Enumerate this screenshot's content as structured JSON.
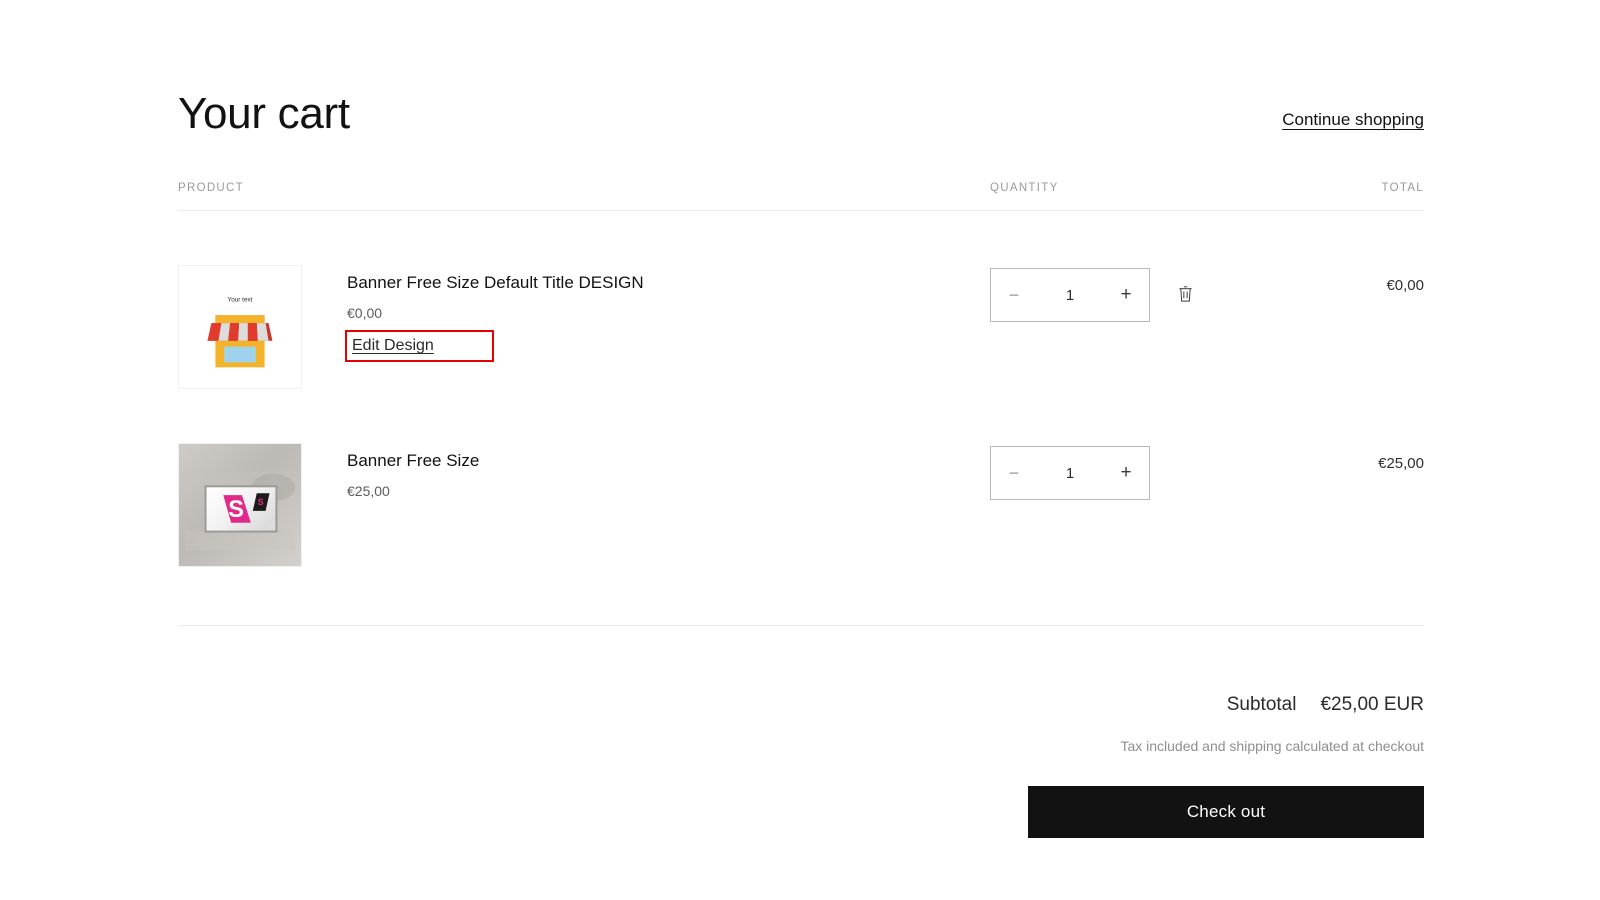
{
  "page": {
    "title": "Your cart",
    "continue_shopping_label": "Continue shopping"
  },
  "table": {
    "headers": {
      "product": "PRODUCT",
      "quantity": "QUANTITY",
      "total": "TOTAL"
    }
  },
  "items": [
    {
      "title": "Banner Free Size Default Title DESIGN",
      "price": "€0,00",
      "edit_link_label": "Edit Design",
      "quantity": "1",
      "decrease_label": "−",
      "increase_label": "+",
      "line_total": "€0,00",
      "thumbnail_icon": "storefront-icon",
      "thumbnail_caption": "Your text",
      "has_remove_button": true
    },
    {
      "title": "Banner Free Size",
      "price": "€25,00",
      "quantity": "1",
      "decrease_label": "−",
      "increase_label": "+",
      "line_total": "€25,00",
      "thumbnail_icon": "banner-flag-mockup-image",
      "has_remove_button": false
    }
  ],
  "footer": {
    "subtotal_label": "Subtotal",
    "subtotal_value": "€25,00 EUR",
    "tax_note": "Tax included and shipping calculated at checkout",
    "checkout_label": "Check out"
  },
  "colors": {
    "highlight_box": "#e60000",
    "checkout_background": "#121212",
    "text_primary": "#121212",
    "text_muted": "#8e8e8e",
    "awning_red": "#e03b2d",
    "store_yellow": "#f5b32c",
    "flag_magenta": "#e12a8a"
  }
}
